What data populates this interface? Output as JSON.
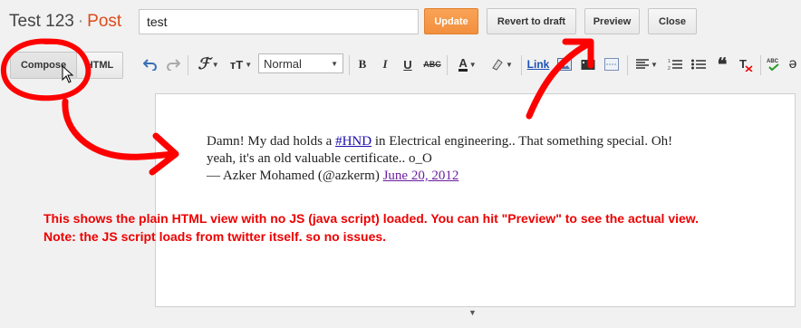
{
  "header": {
    "blog_title": "Test 123",
    "separator": "·",
    "page_type": "Post",
    "title_value": "test",
    "buttons": {
      "update": "Update",
      "revert": "Revert to draft",
      "preview": "Preview",
      "close": "Close"
    }
  },
  "toolbar": {
    "compose_label": "Compose",
    "html_label": "HTML",
    "font_size_value": "Normal",
    "link_label": "Link"
  },
  "tweet": {
    "line1_before": "Damn! My dad holds a ",
    "hashtag": "#HND",
    "line1_after": " in Electrical engineering.. That something special. Oh!",
    "line2": "yeah, it's an old valuable certificate.. o_O",
    "attribution": "— Azker Mohamed (@azkerm) ",
    "date_link": "June 20, 2012"
  },
  "annotation": {
    "line1": "This shows the plain HTML view with no JS (java script) loaded. You can hit \"Preview\" to see the actual view.",
    "line2": "Note: the JS script loads from twitter itself. so no issues."
  },
  "colors": {
    "accent_orange": "#dd4b1a",
    "update_button": "#f49a46",
    "annotation_red": "#ee0000",
    "link_blue": "#1a0dab"
  }
}
